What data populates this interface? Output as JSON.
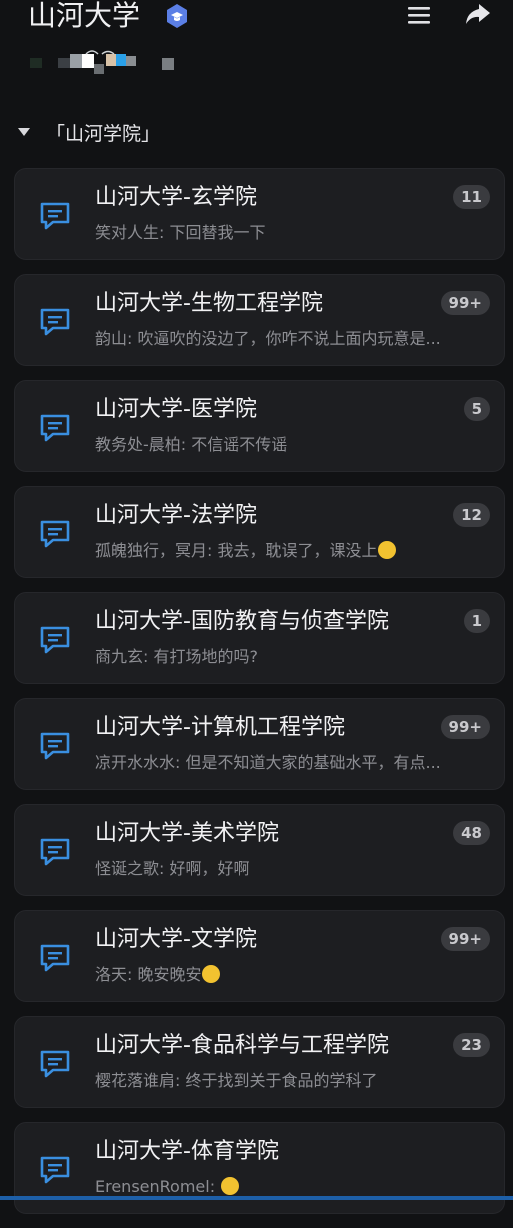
{
  "header": {
    "title": "山河大学",
    "verified_icon": "verified-badge-icon",
    "menu_icon": "menu-icon",
    "share_icon": "share-icon"
  },
  "section": {
    "label": "「山河学院」"
  },
  "groups": [
    {
      "title": "山河大学-玄学院",
      "preview": "笑对人生: 下回替我一下",
      "badge": "11"
    },
    {
      "title": "山河大学-生物工程学院",
      "preview": "韵山: 吹逼吹的没边了，你咋不说上面内玩意是...",
      "badge": "99+"
    },
    {
      "title": "山河大学-医学院",
      "preview": "教务处-晨柏: 不信谣不传谣",
      "badge": "5"
    },
    {
      "title": "山河大学-法学院",
      "preview": "孤魄独行，冥月: 我去，耽误了，课没上",
      "badge": "12",
      "emoji": "crying-face"
    },
    {
      "title": "山河大学-国防教育与侦查学院",
      "preview": "商九玄: 有打场地的吗?",
      "badge": "1"
    },
    {
      "title": "山河大学-计算机工程学院",
      "preview": "凉开水水水: 但是不知道大家的基础水平，有点...",
      "badge": "99+"
    },
    {
      "title": "山河大学-美术学院",
      "preview": "怪诞之歌: 好啊，好啊",
      "badge": "48"
    },
    {
      "title": "山河大学-文学院",
      "preview": "洛天: 晚安晚安",
      "badge": "99+",
      "emoji": "sleepy-face"
    },
    {
      "title": "山河大学-食品科学与工程学院",
      "preview": "樱花落谁肩: 终于找到关于食品的学科了",
      "badge": "23"
    },
    {
      "title": "山河大学-体育学院",
      "preview": "ErensenRomel: ",
      "badge": "",
      "emoji": "grinning-face"
    }
  ],
  "colors": {
    "background": "#111214",
    "card": "#1d1e21",
    "accent": "#3a8fe0",
    "badge": "#3a3b3f",
    "verified": "#5b7fe6"
  }
}
